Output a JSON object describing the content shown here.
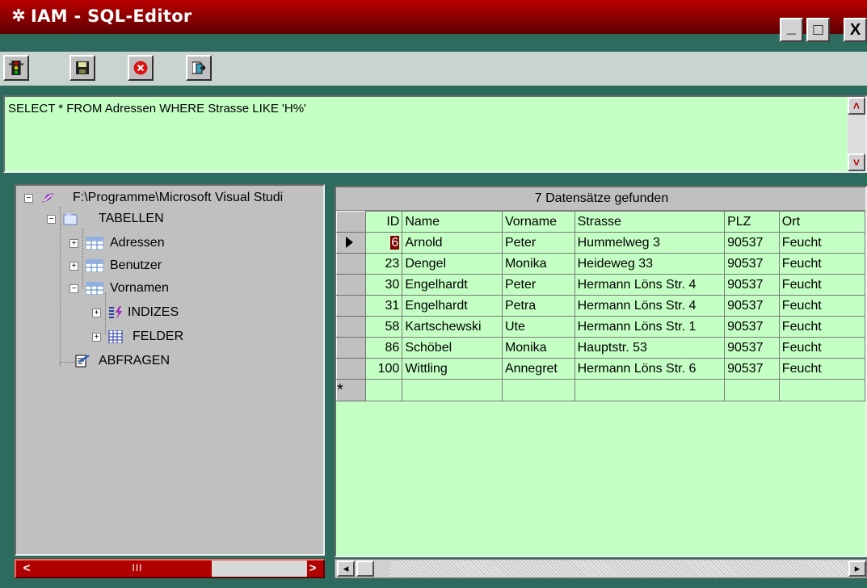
{
  "window": {
    "title": "IAM - SQL-Editor",
    "title_icon": "gear-icon",
    "buttons": {
      "minimize": "_",
      "maximize": "□",
      "close": "X"
    }
  },
  "toolbar": {
    "items": [
      {
        "name": "traffic-light-icon"
      },
      {
        "name": "save-icon"
      },
      {
        "name": "stop-icon"
      },
      {
        "name": "exit-icon"
      }
    ]
  },
  "sql": {
    "query": "SELECT * FROM Adressen WHERE Strasse LIKE 'H%'"
  },
  "tree": {
    "root": "F:\\Programme\\Microsoft Visual Studi",
    "tabellen": "TABELLEN",
    "tables": [
      "Adressen",
      "Benutzer",
      "Vornamen"
    ],
    "indizes": "INDIZES",
    "felder": "FELDER",
    "abfragen": "ABFRAGEN",
    "scroll_thumb": "III"
  },
  "grid": {
    "caption": "7 Datensätze gefunden",
    "columns": [
      "ID",
      "Name",
      "Vorname",
      "Strasse",
      "PLZ",
      "Ort"
    ],
    "rows": [
      [
        "6",
        "Arnold",
        "Peter",
        "Hummelweg 3",
        "90537",
        "Feucht"
      ],
      [
        "23",
        "Dengel",
        "Monika",
        "Heideweg 33",
        "90537",
        "Feucht"
      ],
      [
        "30",
        "Engelhardt",
        "Peter",
        "Hermann Löns Str. 4",
        "90537",
        "Feucht"
      ],
      [
        "31",
        "Engelhardt",
        "Petra",
        "Hermann Löns Str. 4",
        "90537",
        "Feucht"
      ],
      [
        "58",
        "Kartschewski",
        "Ute",
        "Hermann Löns Str. 1",
        "90537",
        "Feucht"
      ],
      [
        "86",
        "Schöbel",
        "Monika",
        "Hauptstr. 53",
        "90537",
        "Feucht"
      ],
      [
        "100",
        "Wittling",
        "Annegret",
        "Hermann Löns Str. 6",
        "90537",
        "Feucht"
      ]
    ],
    "new_row_marker": "*"
  }
}
